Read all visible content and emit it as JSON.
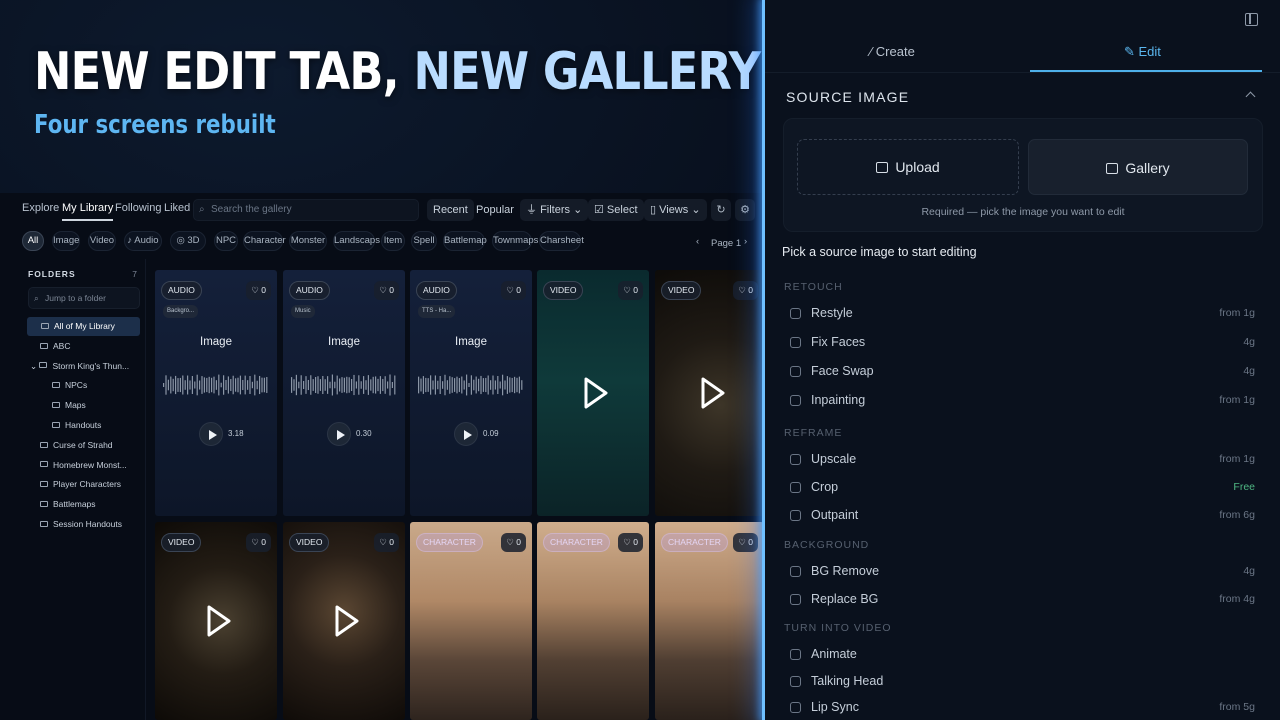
{
  "hero": {
    "title_a": "NEW EDIT TAB, ",
    "title_b": "NEW GALLERY",
    "subtitle": "Four screens rebuilt"
  },
  "gallery": {
    "nav": [
      "Explore",
      "My Library",
      "Following",
      "Liked"
    ],
    "active_nav": "My Library",
    "search_placeholder": "Search the gallery",
    "sort": [
      "Recent",
      "Popular"
    ],
    "filters_label": "Filters",
    "select_label": "Select",
    "views_label": "Views",
    "chips": [
      "All",
      "Image",
      "Video",
      "Audio",
      "3D",
      "NPC",
      "Character",
      "Monster",
      "Landscaps",
      "Item",
      "Spell",
      "Battlemap",
      "Townmaps",
      "Charsheet"
    ],
    "page_label": "Page 1",
    "folders": {
      "heading": "FOLDERS",
      "count": "7",
      "jump_placeholder": "Jump to a folder",
      "items": [
        "All of My Library",
        "ABC",
        "Storm King's Thun...",
        "NPCs",
        "Maps",
        "Handouts",
        "Curse of Strahd",
        "Homebrew Monst...",
        "Player Characters",
        "Battlemaps",
        "Session Handouts"
      ]
    },
    "cards": [
      {
        "badge": "AUDIO",
        "likes": "0",
        "sub": "Backgro...",
        "title": "Image",
        "duration": "3.18"
      },
      {
        "badge": "AUDIO",
        "likes": "0",
        "sub": "Music",
        "title": "Image",
        "duration": "0.30"
      },
      {
        "badge": "AUDIO",
        "likes": "0",
        "sub": "TTS - Ha...",
        "title": "Image",
        "duration": "0.09"
      },
      {
        "badge": "VIDEO",
        "likes": "0"
      },
      {
        "badge": "VIDEO",
        "likes": "0"
      },
      {
        "badge": "VIDEO",
        "likes": "0"
      },
      {
        "badge": "VIDEO",
        "likes": "0"
      },
      {
        "badge": "CHARACTER",
        "likes": "0"
      },
      {
        "badge": "CHARACTER",
        "likes": "0"
      },
      {
        "badge": "CHARACTER",
        "likes": "0"
      }
    ]
  },
  "panel": {
    "tabs": [
      "Create",
      "Edit"
    ],
    "active_tab": "Edit",
    "section_title": "SOURCE IMAGE",
    "upload_label": "Upload",
    "gallery_label": "Gallery",
    "source_hint": "Required — pick the image you want to edit",
    "pick_prompt": "Pick a source image to start editing",
    "groups": [
      {
        "name": "RETOUCH",
        "tools": [
          {
            "name": "Restyle",
            "cost": "from 1g"
          },
          {
            "name": "Fix Faces",
            "cost": "4g"
          },
          {
            "name": "Face Swap",
            "cost": "4g"
          },
          {
            "name": "Inpainting",
            "cost": "from 1g"
          }
        ]
      },
      {
        "name": "REFRAME",
        "tools": [
          {
            "name": "Upscale",
            "cost": "from 1g"
          },
          {
            "name": "Crop",
            "cost": "Free"
          },
          {
            "name": "Outpaint",
            "cost": "from 6g"
          }
        ]
      },
      {
        "name": "BACKGROUND",
        "tools": [
          {
            "name": "BG Remove",
            "cost": "4g"
          },
          {
            "name": "Replace BG",
            "cost": "from 4g"
          }
        ]
      },
      {
        "name": "TURN INTO VIDEO",
        "tools": [
          {
            "name": "Animate",
            "cost": ""
          },
          {
            "name": "Talking Head",
            "cost": ""
          },
          {
            "name": "Lip Sync",
            "cost": "from 5g"
          }
        ]
      }
    ]
  },
  "colors": {
    "accent": "#4eb0ea",
    "divider": "#6fc0ff",
    "free": "#4fb884"
  }
}
